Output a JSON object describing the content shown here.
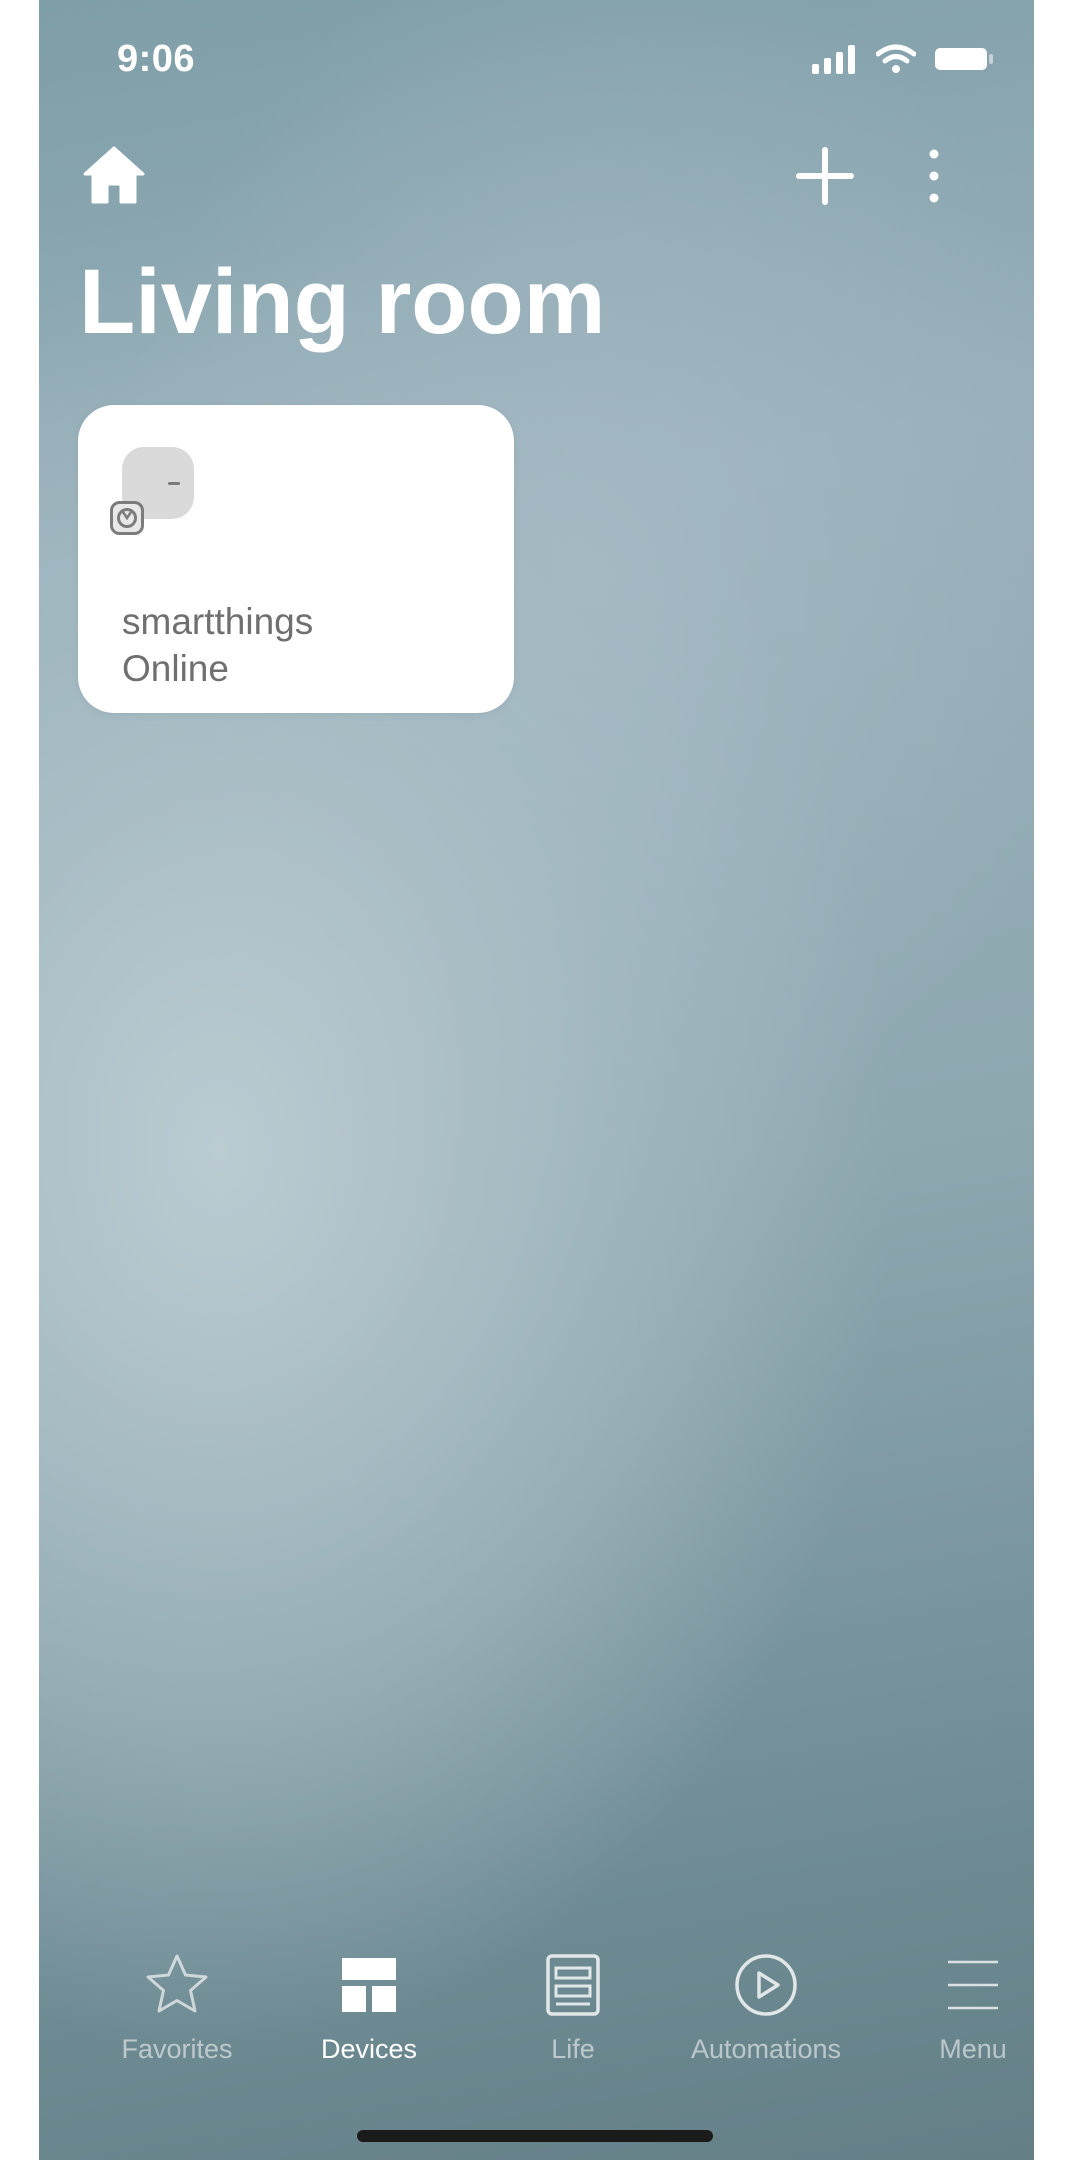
{
  "status_bar": {
    "time": "9:06",
    "icons": [
      "signal-icon",
      "wifi-icon",
      "battery-icon"
    ]
  },
  "header": {
    "left_icon": "home-icon",
    "right_icons": [
      "plus-icon",
      "more-vertical-icon"
    ],
    "title": "Living room"
  },
  "devices": [
    {
      "name": "smartthings",
      "status": "Online",
      "icon": "hub-device-icon",
      "badge_icon": "connection-badge-icon"
    }
  ],
  "bottom_nav": {
    "items": [
      {
        "label": "Favorites",
        "icon": "star-icon",
        "active": false
      },
      {
        "label": "Devices",
        "icon": "grid-icon",
        "active": true
      },
      {
        "label": "Life",
        "icon": "life-icon",
        "active": false
      },
      {
        "label": "Automations",
        "icon": "play-circle-icon",
        "active": false
      },
      {
        "label": "Menu",
        "icon": "menu-icon",
        "active": false
      }
    ]
  },
  "colors": {
    "background_top": "#7e9ea8",
    "background_bottom": "#647f86",
    "card": "#ffffff",
    "card_text": "#6f6f6f",
    "nav_active": "#ffffff"
  }
}
